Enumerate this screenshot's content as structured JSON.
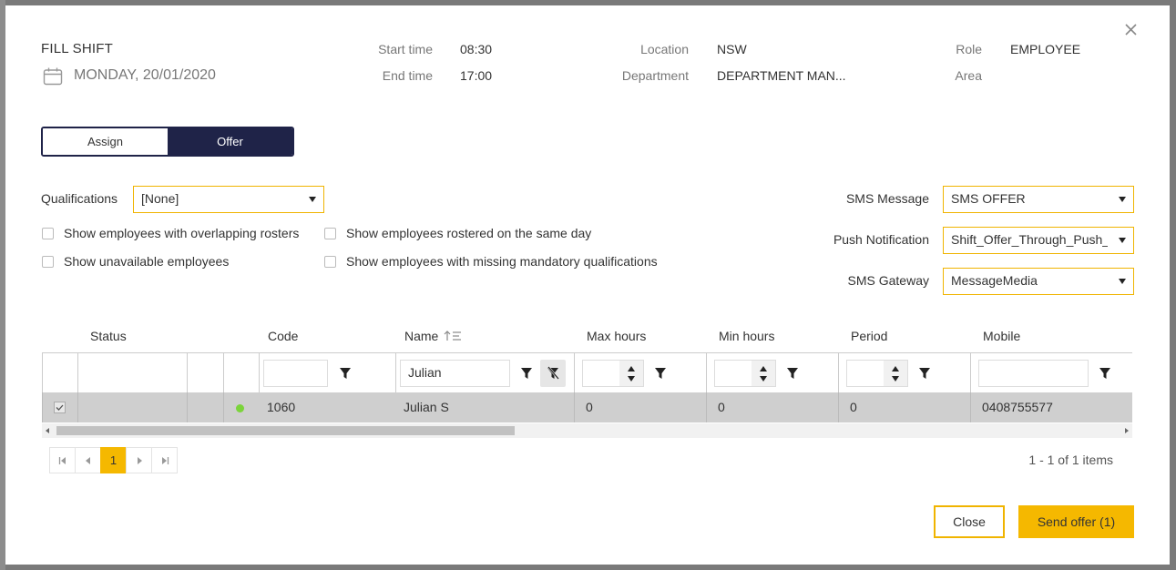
{
  "header": {
    "title": "FILL SHIFT",
    "date": "MONDAY, 20/01/2020",
    "start_time_label": "Start time",
    "start_time": "08:30",
    "end_time_label": "End time",
    "end_time": "17:00",
    "location_label": "Location",
    "location": "NSW",
    "department_label": "Department",
    "department": "DEPARTMENT MAN...",
    "role_label": "Role",
    "role": "EMPLOYEE",
    "area_label": "Area"
  },
  "mode_toggle": {
    "assign": "Assign",
    "offer": "Offer",
    "selected": "Offer"
  },
  "qualifications": {
    "label": "Qualifications",
    "value": "[None]"
  },
  "checkboxes": {
    "overlapping": "Show employees with overlapping rosters",
    "same_day": "Show employees rostered on the same day",
    "unavailable": "Show unavailable employees",
    "missing_quals": "Show employees with missing mandatory qualifications"
  },
  "sms_message": {
    "label": "SMS Message",
    "value": "SMS OFFER"
  },
  "push_notification": {
    "label": "Push Notification",
    "value": "Shift_Offer_Through_Push_N"
  },
  "sms_gateway": {
    "label": "SMS Gateway",
    "value": "MessageMedia"
  },
  "grid": {
    "columns": [
      "Status",
      "Code",
      "Name",
      "Max hours",
      "Min hours",
      "Period",
      "Mobile"
    ],
    "name_filter": "Julian",
    "rows": [
      {
        "code": "1060",
        "name": "Julian S",
        "max_hours": "0",
        "min_hours": "0",
        "period": "0",
        "mobile": "0408755577"
      }
    ]
  },
  "pager": {
    "current_page": "1",
    "summary": "1 - 1 of 1 items"
  },
  "footer": {
    "close": "Close",
    "send": "Send offer (1)"
  },
  "colors": {
    "accent": "#f5b800",
    "navy": "#1f2348",
    "available": "#7bd43b"
  }
}
